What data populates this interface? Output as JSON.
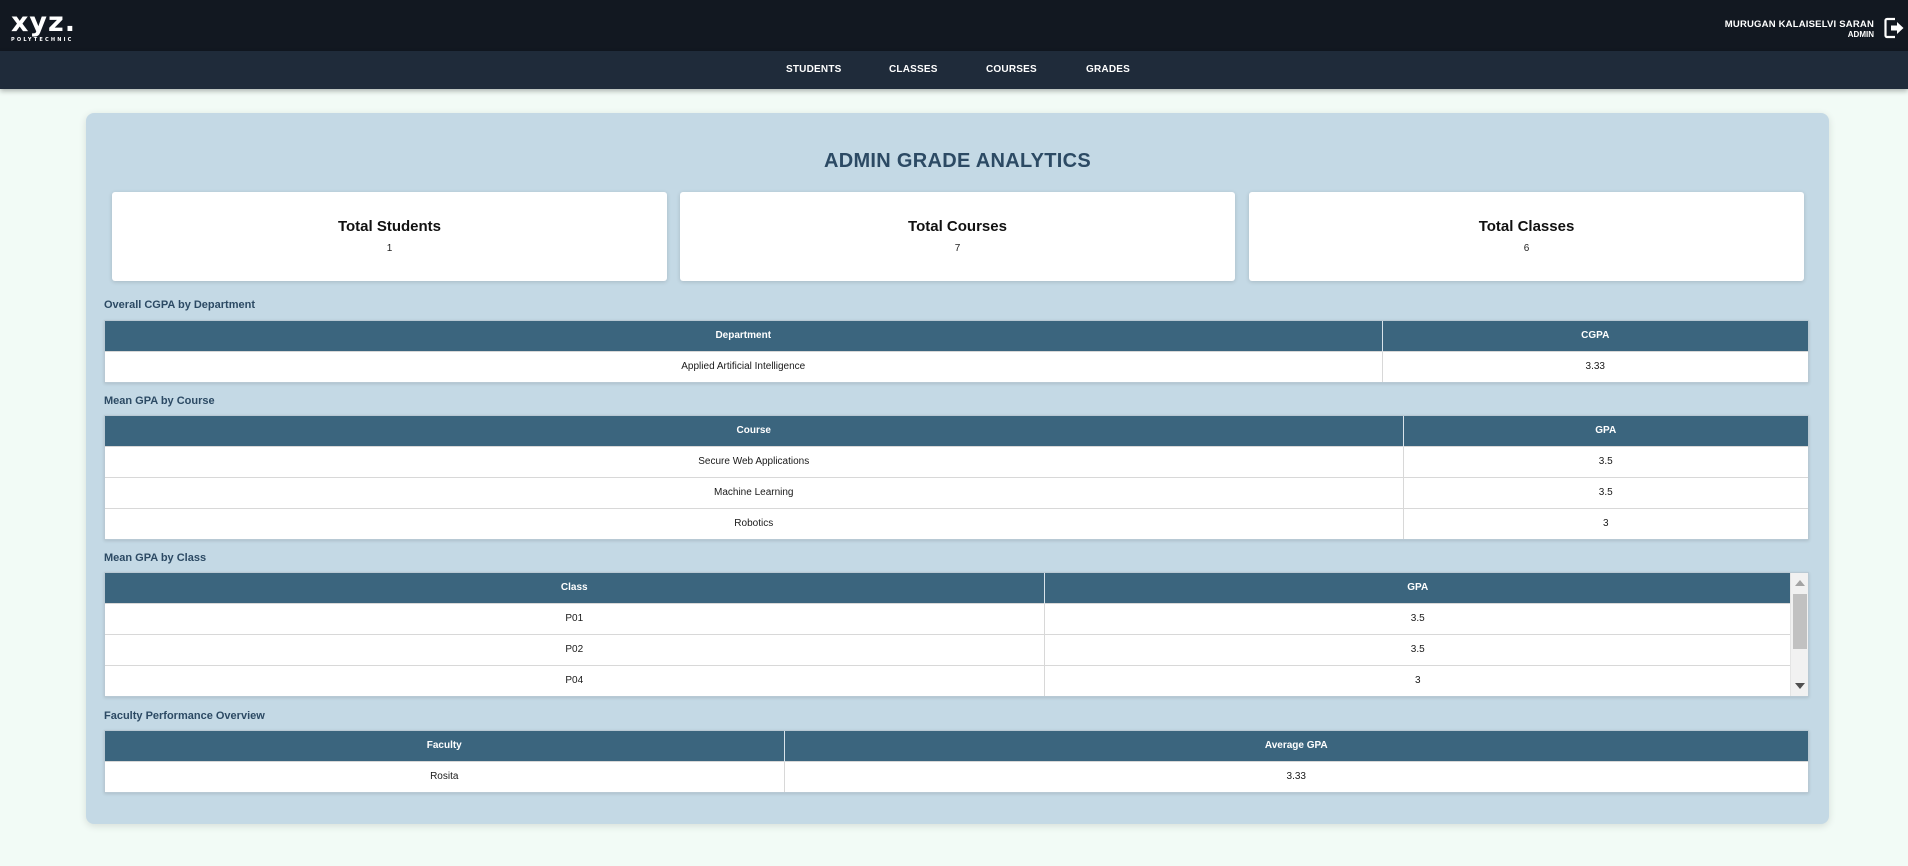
{
  "brand": {
    "name": "xyz.",
    "subtitle": "POLYTECHNIC"
  },
  "user": {
    "name": "MURUGAN KALAISELVI SARAN",
    "role": "ADMIN",
    "logout_icon": "logout-icon"
  },
  "nav": {
    "items": [
      "STUDENTS",
      "CLASSES",
      "COURSES",
      "GRADES"
    ]
  },
  "page": {
    "title": "ADMIN GRADE ANALYTICS"
  },
  "stats": [
    {
      "label": "Total Students",
      "value": "1"
    },
    {
      "label": "Total Courses",
      "value": "7"
    },
    {
      "label": "Total Classes",
      "value": "6"
    }
  ],
  "dept_table": {
    "title": "Overall CGPA by Department",
    "headers": [
      "Department",
      "CGPA"
    ],
    "rows": [
      [
        "Applied Artificial Intelligence",
        "3.33"
      ]
    ]
  },
  "course_table": {
    "title": "Mean GPA by Course",
    "headers": [
      "Course",
      "GPA"
    ],
    "rows": [
      [
        "Secure Web Applications",
        "3.5"
      ],
      [
        "Machine Learning",
        "3.5"
      ],
      [
        "Robotics",
        "3"
      ]
    ]
  },
  "class_table": {
    "title": "Mean GPA by Class",
    "headers": [
      "Class",
      "GPA"
    ],
    "rows": [
      [
        "P01",
        "3.5"
      ],
      [
        "P02",
        "3.5"
      ],
      [
        "P04",
        "3"
      ]
    ]
  },
  "faculty_table": {
    "title": "Faculty Performance Overview",
    "headers": [
      "Faculty",
      "Average GPA"
    ],
    "rows": [
      [
        "Rosita",
        "3.33"
      ]
    ]
  },
  "colors": {
    "header_bg": "#121821",
    "nav_bg": "#1f2b3a",
    "panel_bg": "#c4d9e5",
    "table_header": "#3b657e",
    "title_text": "#2c4a64"
  }
}
